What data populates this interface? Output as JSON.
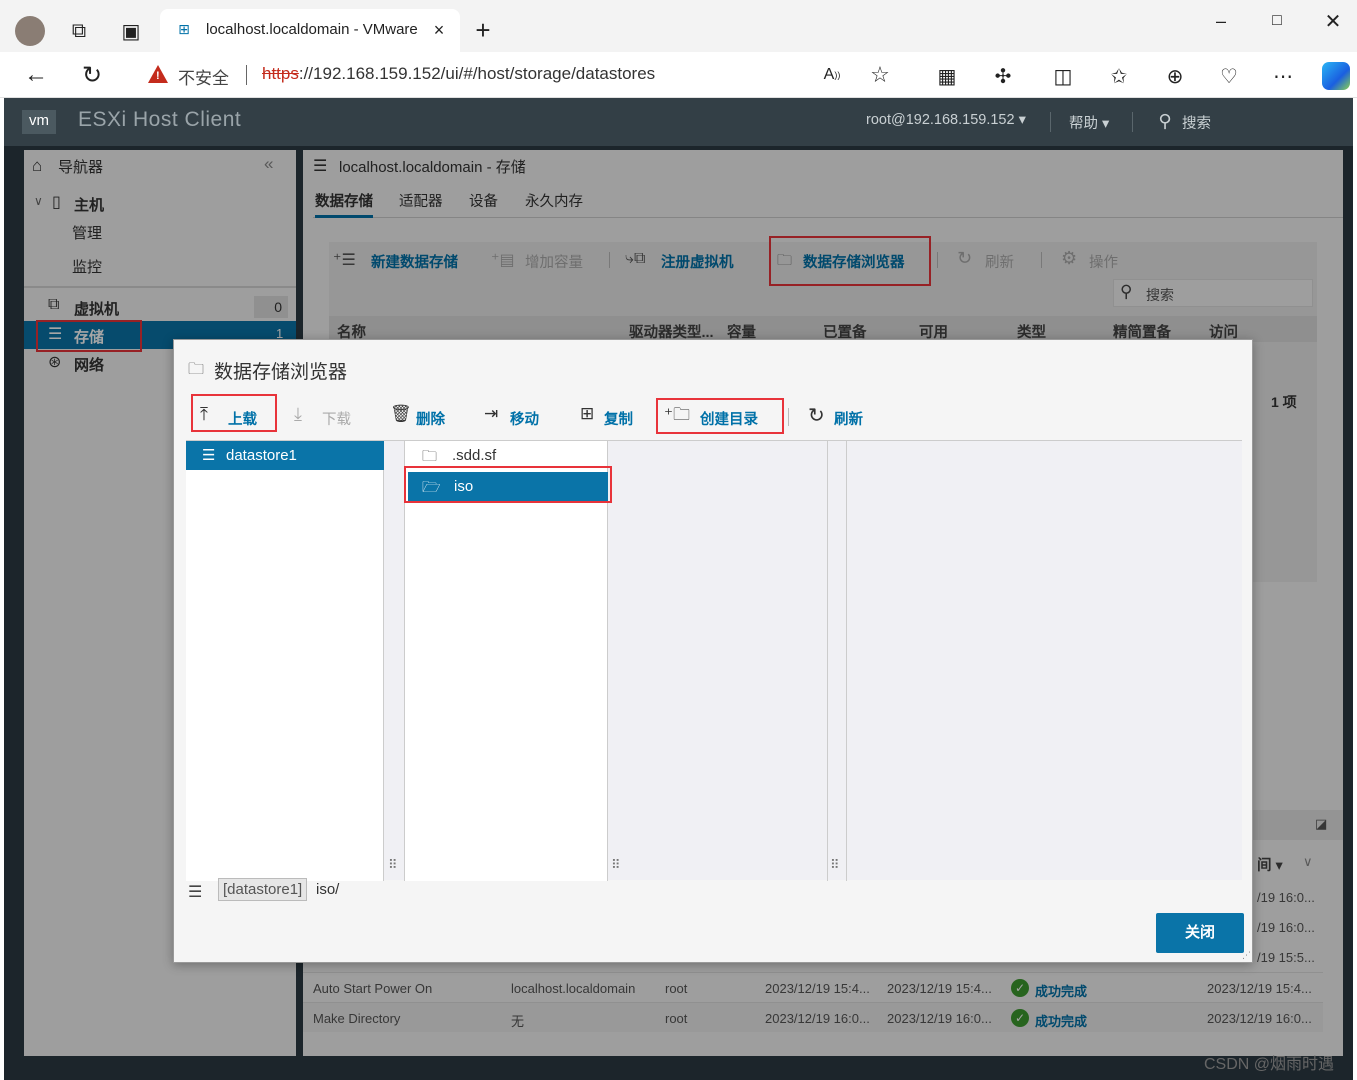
{
  "browser": {
    "tab_title": "localhost.localdomain - VMware",
    "insecure_label": "不安全",
    "url_scheme": "https",
    "url_rest": "://192.168.159.152/ui/#/host/storage/datastores"
  },
  "app": {
    "logo": "vm",
    "title": "ESXi Host Client",
    "user": "root@192.168.159.152 ▾",
    "help": "帮助 ▾",
    "search": "搜索"
  },
  "nav": {
    "title": "导航器",
    "host": "主机",
    "manage": "管理",
    "monitor": "监控",
    "vms": "虚拟机",
    "vms_count": "0",
    "storage": "存储",
    "storage_count": "1",
    "network": "网络"
  },
  "main": {
    "title": "localhost.localdomain - 存储",
    "tabs": [
      "数据存储",
      "适配器",
      "设备",
      "永久内存"
    ],
    "toolbar": {
      "new_ds": "新建数据存储",
      "increase": "增加容量",
      "register_vm": "注册虚拟机",
      "browser": "数据存储浏览器",
      "refresh": "刷新",
      "actions": "操作"
    },
    "search_placeholder": "搜索",
    "columns": [
      "名称",
      "驱动器类型...",
      "容量",
      "已置备",
      "可用",
      "类型",
      "精简置备",
      "访问"
    ],
    "items_count": "1 项"
  },
  "dialog": {
    "title": "数据存储浏览器",
    "toolbar": {
      "upload": "上载",
      "download": "下载",
      "delete": "删除",
      "move": "移动",
      "copy": "复制",
      "mkdir": "创建目录",
      "refresh": "刷新"
    },
    "datastore": "datastore1",
    "folders": [
      ".sdd.sf",
      "iso"
    ],
    "path_ds": "[datastore1]",
    "path_rest": "iso/",
    "close": "关闭"
  },
  "tasks": {
    "col_partial": "间 ▾",
    "rows": [
      {
        "task": "Auto Start Power On",
        "target": "localhost.localdomain",
        "user": "root",
        "queued": "2023/12/19 15:4...",
        "started": "2023/12/19 15:4...",
        "result": "成功完成",
        "completed": "2023/12/19 15:4..."
      },
      {
        "task": "Make Directory",
        "target": "无",
        "user": "root",
        "queued": "2023/12/19 16:0...",
        "started": "2023/12/19 16:0...",
        "result": "成功完成",
        "completed": "2023/12/19 16:0..."
      }
    ],
    "partial_times": [
      "/19 16:0...",
      "/19 16:0...",
      "/19 15:5..."
    ]
  },
  "watermark": "CSDN @烟雨时遇",
  "colors": {
    "accent": "#0071a8",
    "highlight": "#e8333a",
    "selected": "#0a74a8"
  }
}
